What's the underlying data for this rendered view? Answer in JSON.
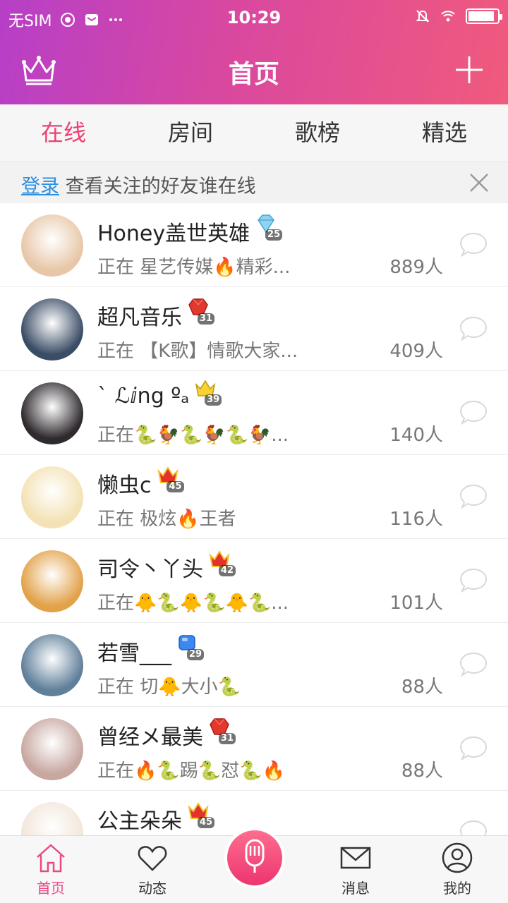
{
  "status_bar": {
    "carrier": "无SIM",
    "time": "10:29",
    "battery_level": 0.9
  },
  "nav": {
    "title": "首页",
    "left_icon": "crown-icon",
    "right_icon": "plus-icon"
  },
  "tabs": [
    {
      "label": "在线",
      "active": true
    },
    {
      "label": "房间",
      "active": false
    },
    {
      "label": "歌榜",
      "active": false
    },
    {
      "label": "精选",
      "active": false
    }
  ],
  "notice": {
    "link": "登录",
    "text": "查看关注的好友谁在线"
  },
  "colors": {
    "accent": "#ee3f72",
    "link": "#2a8fe0",
    "header_start": "#b63fc8",
    "header_end": "#f05a7d"
  },
  "users": [
    {
      "name": "Honey盖世英雄",
      "level": "25",
      "badge": "diamond",
      "status": "正在 星艺传媒🔥精彩...",
      "count": "889人",
      "avatar": "#e8c7a8"
    },
    {
      "name": "超凡音乐",
      "level": "31",
      "badge": "red-gem",
      "status": "正在 【K歌】情歌大家...",
      "count": "409人",
      "avatar": "#3b4d66"
    },
    {
      "name": "ˋ ℒⅈng ºₐ",
      "level": "39",
      "badge": "gold-crown",
      "status": "正在🐍🐓🐍🐓🐍🐓...",
      "count": "140人",
      "avatar": "#2f2a2e"
    },
    {
      "name": "懒虫c",
      "level": "45",
      "badge": "red-crown",
      "status": "正在 极炫🔥王者",
      "count": "116人",
      "avatar": "#f3e2b4"
    },
    {
      "name": "司令丶丫头",
      "level": "42",
      "badge": "red-crown",
      "status": "正在🐥🐍🐥🐍🐥🐍...",
      "count": "101人",
      "avatar": "#e2a24a"
    },
    {
      "name": "若雪___",
      "level": "29",
      "badge": "blue-gem",
      "status": "正在 切🐥大小🐍",
      "count": "88人",
      "avatar": "#5f7f9a"
    },
    {
      "name": "曾经メ最美",
      "level": "31",
      "badge": "red-gem",
      "status": "正在🔥🐍踢🐍怼🐍🔥",
      "count": "88人",
      "avatar": "#c7a7a0"
    },
    {
      "name": "公主朵朵",
      "level": "45",
      "badge": "red-crown",
      "status": "",
      "count": "",
      "avatar": "#f2e6da"
    }
  ],
  "bottom_nav": {
    "items": [
      {
        "label": "首页",
        "icon": "home-icon",
        "active": true
      },
      {
        "label": "动态",
        "icon": "heart-icon",
        "active": false
      },
      {
        "label": "",
        "icon": "microphone-icon",
        "active": false
      },
      {
        "label": "消息",
        "icon": "mail-icon",
        "active": false
      },
      {
        "label": "我的",
        "icon": "profile-icon",
        "active": false
      }
    ]
  }
}
